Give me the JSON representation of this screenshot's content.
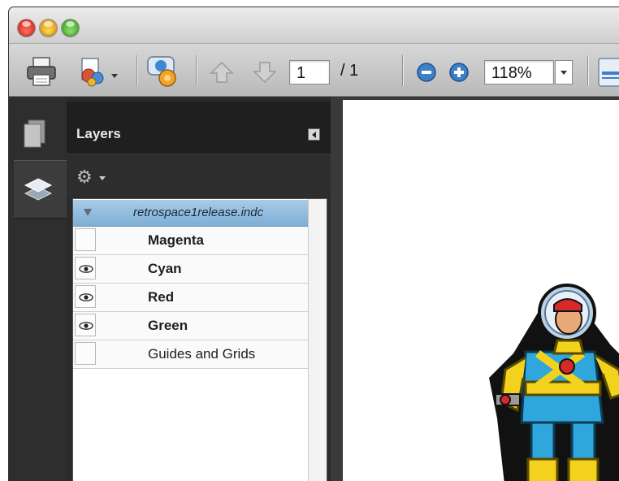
{
  "window": {
    "traffic_lights": [
      "close",
      "minimize",
      "zoom"
    ]
  },
  "toolbar": {
    "page_current": "1",
    "page_total": "/ 1",
    "zoom": "118%",
    "icons": [
      "print-icon",
      "share-icon",
      "review-icon",
      "previous-page-icon",
      "next-page-icon",
      "zoom-out-icon",
      "zoom-in-icon",
      "page-view-icon"
    ]
  },
  "sidebar": {
    "nav_icons": [
      "pages-icon",
      "layers-icon"
    ]
  },
  "layers_panel": {
    "title": "Layers",
    "options_icon": "gear-icon",
    "root": {
      "label": "retrospace1release.indc",
      "expanded": true
    },
    "layers": [
      {
        "label": "Magenta",
        "visible": false,
        "bold": true
      },
      {
        "label": "Cyan",
        "visible": true,
        "bold": true
      },
      {
        "label": "Red",
        "visible": true,
        "bold": true
      },
      {
        "label": "Green",
        "visible": true,
        "bold": true
      },
      {
        "label": "Guides and Grids",
        "visible": false,
        "bold": false
      }
    ]
  },
  "colors": {
    "selection": "#7eaed6",
    "panel_bg": "#2a2a2a",
    "toolbar_bg": "#c9c9c9"
  }
}
